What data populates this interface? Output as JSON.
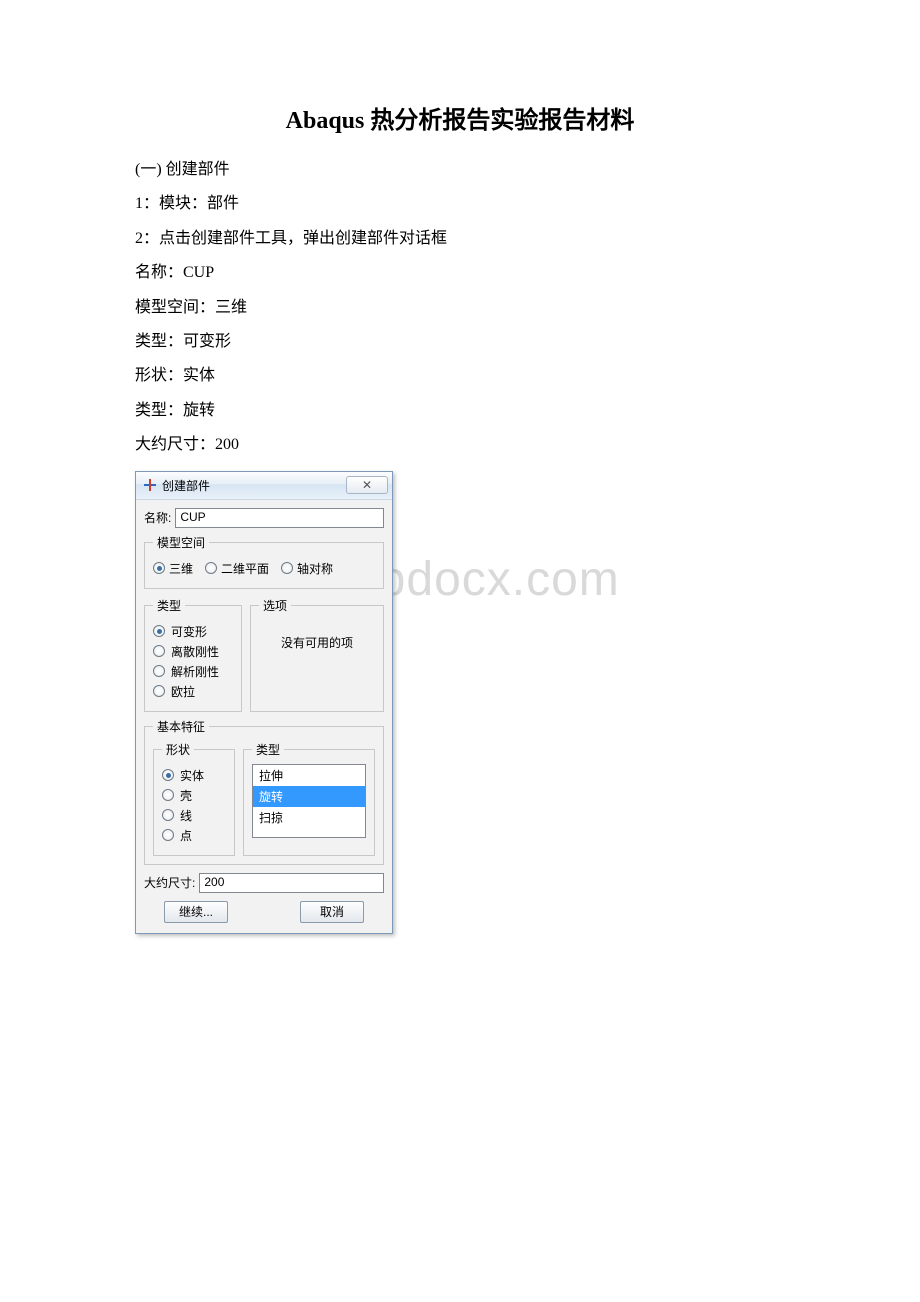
{
  "doc": {
    "title": "Abaqus 热分析报告实验报告材料",
    "section": "(一) 创建部件",
    "step1": "1：模块：部件",
    "step2": "2：点击创建部件工具，弹出创建部件对话框",
    "name_line": "名称：CUP",
    "space_line": "模型空间：三维",
    "type_line": "类型：可变形",
    "shape_line": "形状：实体",
    "subtype_line": "类型：旋转",
    "size_line": "大约尺寸：200",
    "watermark": "www.bdocx.com"
  },
  "dialog": {
    "title": "创建部件",
    "close_glyph": "✕",
    "name_label": "名称:",
    "name_value": "CUP",
    "model_space": {
      "legend": "模型空间",
      "opts": [
        "三维",
        "二维平面",
        "轴对称"
      ],
      "selected": 0
    },
    "type_group": {
      "legend": "类型",
      "opts": [
        "可变形",
        "离散刚性",
        "解析刚性",
        "欧拉"
      ],
      "selected": 0
    },
    "options_group": {
      "legend": "选项",
      "note": "没有可用的项"
    },
    "base_feature": {
      "legend": "基本特征",
      "shape": {
        "legend": "形状",
        "opts": [
          "实体",
          "壳",
          "线",
          "点"
        ],
        "selected": 0
      },
      "subtype": {
        "legend": "类型",
        "items": [
          "拉伸",
          "旋转",
          "扫掠"
        ],
        "selected": 1
      }
    },
    "approx_size_label": "大约尺寸:",
    "approx_size_value": "200",
    "continue_btn": "继续...",
    "cancel_btn": "取消"
  }
}
